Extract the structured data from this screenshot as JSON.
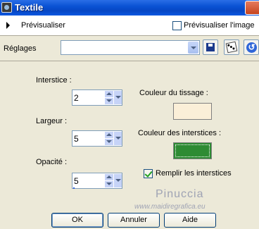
{
  "window": {
    "title": "Textile"
  },
  "preview": {
    "label": "Prévisualiser",
    "preview_image_label": "Prévisualiser l'image",
    "preview_image_checked": false
  },
  "settings": {
    "label": "Réglages",
    "value": ""
  },
  "fields": {
    "interstice": {
      "label": "Interstice :",
      "value": "2"
    },
    "largeur": {
      "label": "Largeur :",
      "value": "5"
    },
    "opacite": {
      "label": "Opacité :",
      "value": "5"
    }
  },
  "colors": {
    "tissage_label": "Couleur du tissage :",
    "tissage_color": "#fbefd8",
    "interstices_label": "Couleur des interstices :",
    "interstices_color": "#2e8b33"
  },
  "fill_interstices": {
    "label": "Remplir les interstices",
    "checked": true
  },
  "watermark": {
    "line1": "Pinuccia",
    "line2": "www.maidiregrafica.eu"
  },
  "buttons": {
    "ok": "OK",
    "cancel": "Annuler",
    "help": "Aide"
  }
}
